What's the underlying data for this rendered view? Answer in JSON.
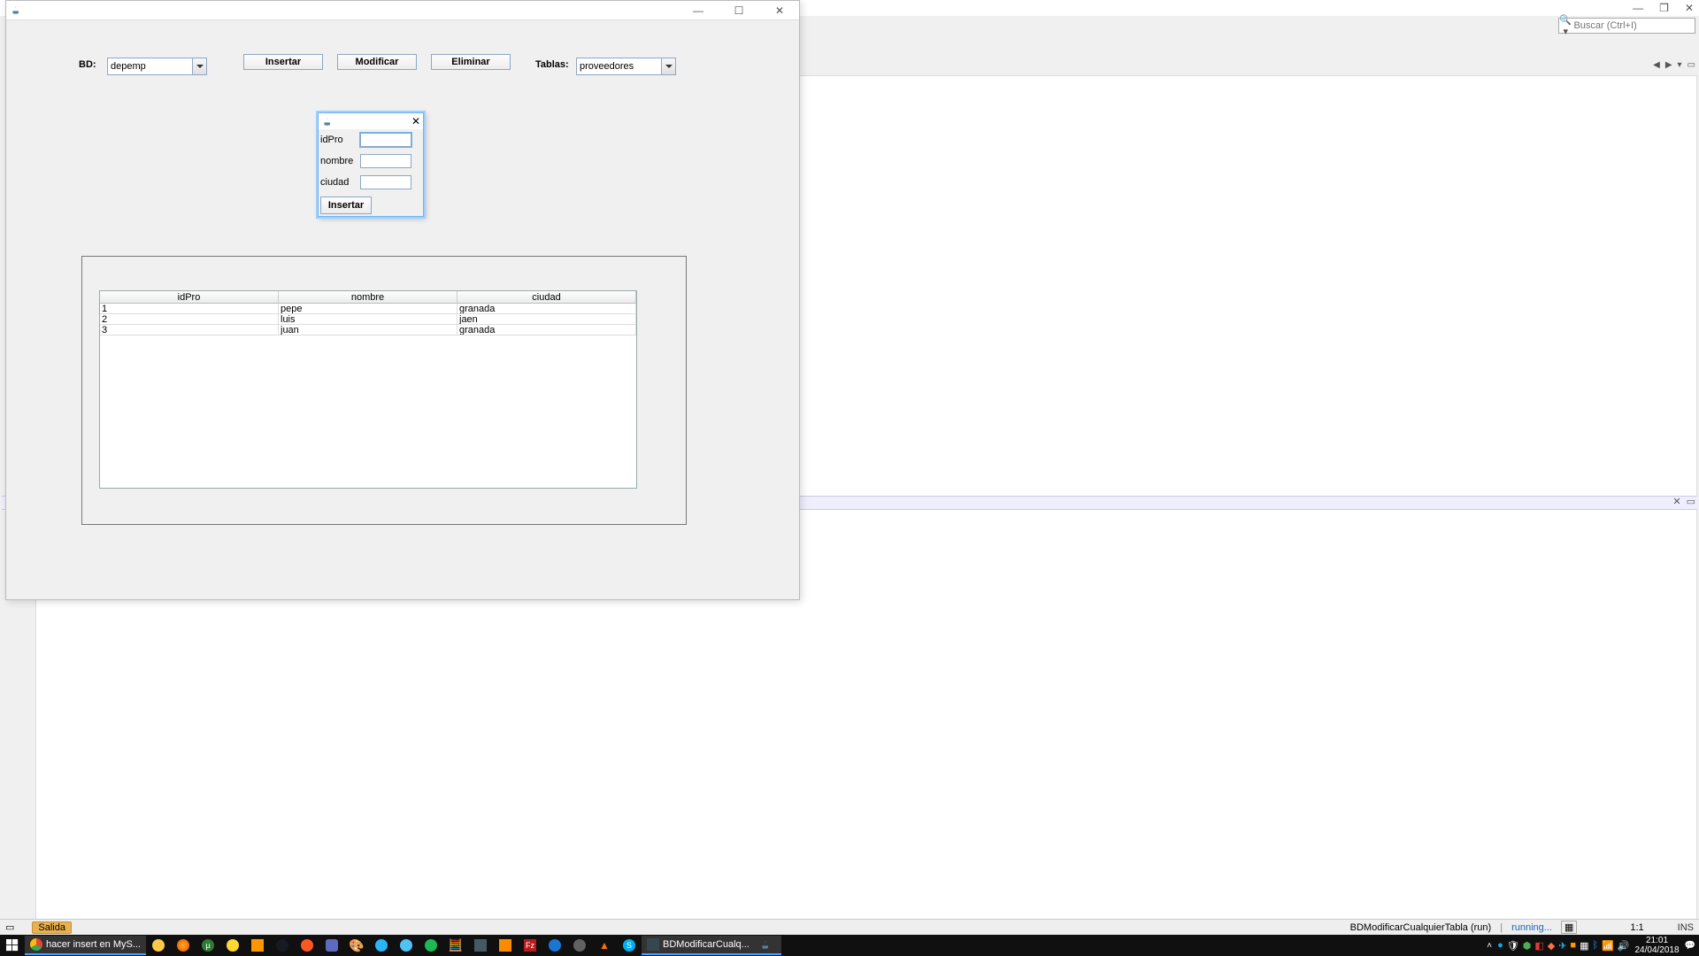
{
  "ide": {
    "search_placeholder": "Buscar (Ctrl+I)",
    "salida_label": "Salida",
    "run_name": "BDModificarCualquierTabla (run)",
    "running_label": "running...",
    "pos_indicator": "1:1",
    "ins_indicator": "INS"
  },
  "main": {
    "bd_label": "BD:",
    "tablas_label": "Tablas:",
    "bd_selected": "depemp",
    "tablas_selected": "proveedores",
    "btn_insertar": "Insertar",
    "btn_modificar": "Modificar",
    "btn_eliminar": "Eliminar",
    "winbtn_min": "—",
    "winbtn_max": "☐",
    "winbtn_close": "✕",
    "table": {
      "headers": [
        "idPro",
        "nombre",
        "ciudad"
      ],
      "rows": [
        {
          "c0": "1",
          "c1": "pepe",
          "c2": "granada"
        },
        {
          "c0": "2",
          "c1": "luis",
          "c2": "jaen"
        },
        {
          "c0": "3",
          "c1": "juan",
          "c2": "granada"
        }
      ]
    }
  },
  "dialog": {
    "field1": "idPro",
    "field2": "nombre",
    "field3": "ciudad",
    "btn": "Insertar",
    "close": "✕",
    "val1": "",
    "val2": "",
    "val3": ""
  },
  "taskbar": {
    "app_ch": "hacer insert en MyS...",
    "app_nb": "BDModificarCualq...",
    "time": "21:01",
    "date": "24/04/2018"
  }
}
